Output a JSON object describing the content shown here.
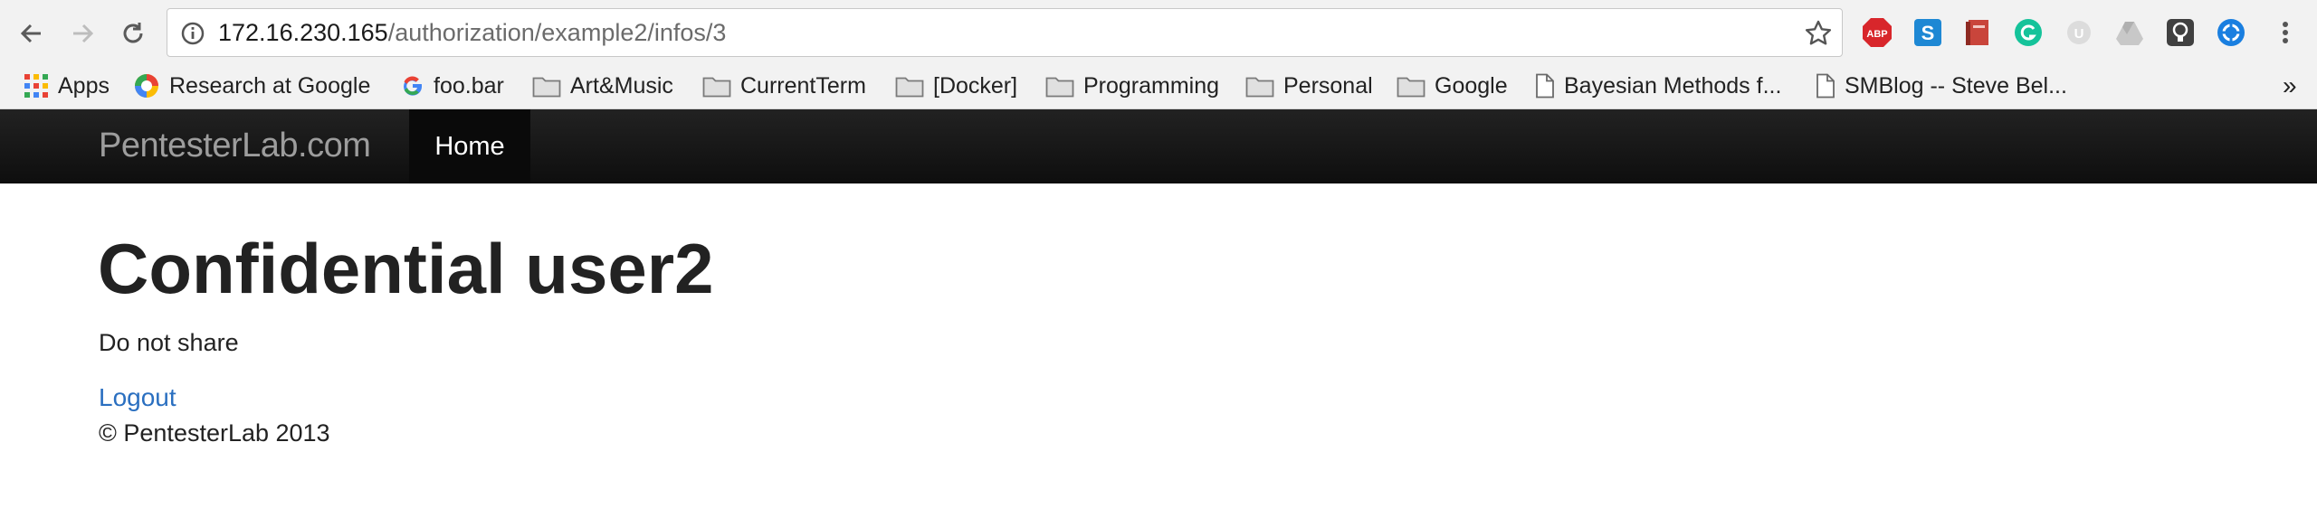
{
  "browser": {
    "url_host": "172.16.230.165",
    "url_path": "/authorization/example2/infos/3",
    "extensions": [
      "adblock-icon",
      "s-extension-icon",
      "book-icon",
      "grammarly-icon",
      "ublock-icon",
      "drive-icon",
      "bulb-icon",
      "pinwheel-icon"
    ]
  },
  "bookmarks": {
    "apps": "Apps",
    "items": [
      "Research at Google",
      "foo.bar",
      "Art&Music",
      "CurrentTerm",
      "[Docker]",
      "Programming",
      "Personal",
      "Google",
      "Bayesian Methods f...",
      "SMBlog -- Steve Bel..."
    ],
    "more": "»"
  },
  "navbar": {
    "brand": "PentesterLab.com",
    "home": "Home"
  },
  "page": {
    "title": "Confidential user2",
    "subtitle": "Do not share",
    "logout": "Logout",
    "footer": "© PentesterLab 2013"
  },
  "colors": {
    "navbar": "#111111",
    "link": "#2a6fc0",
    "toolbar": "#f2f2f2"
  }
}
